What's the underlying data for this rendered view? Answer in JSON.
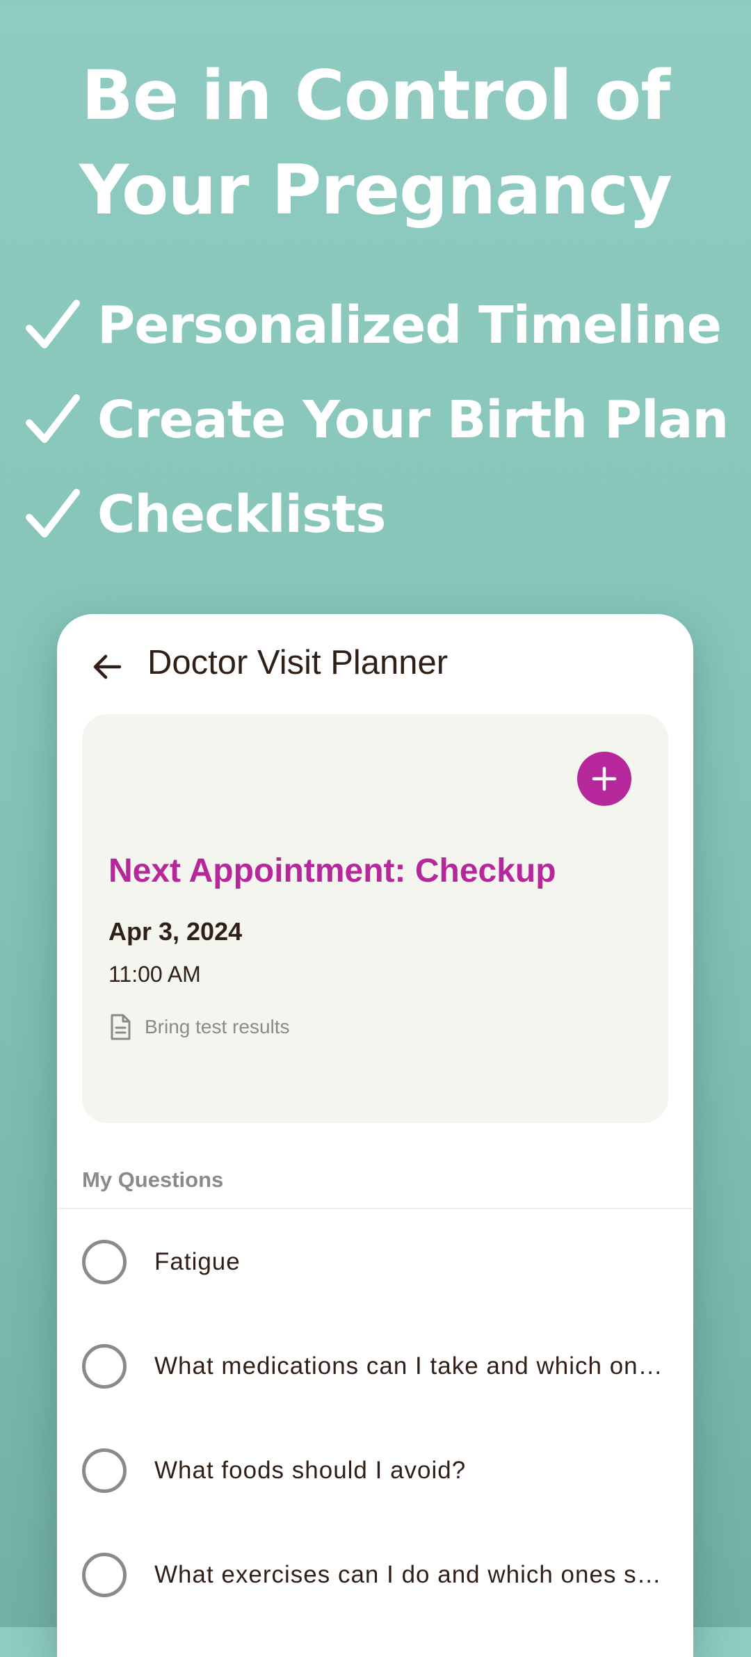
{
  "headline": {
    "line1": "Be in Control of",
    "line2": "Your Pregnancy"
  },
  "features": [
    {
      "icon": "check-icon",
      "label": "Personalized Timeline"
    },
    {
      "icon": "check-icon",
      "label": "Create Your Birth Plan"
    },
    {
      "icon": "check-icon",
      "label": "Checklists"
    }
  ],
  "app": {
    "title": "Doctor Visit Planner",
    "back_icon": "arrow-left-icon",
    "appointment": {
      "add_icon": "plus-icon",
      "title": "Next Appointment: Checkup",
      "date": "Apr 3, 2024",
      "time": "11:00 AM",
      "note_icon": "document-icon",
      "note": "Bring test results"
    },
    "questions_header": "My Questions",
    "questions": [
      {
        "text": "Fatigue",
        "checked": false
      },
      {
        "text": "What medications can I take and which ones should I avoid?",
        "checked": false
      },
      {
        "text": "What foods should I avoid?",
        "checked": false
      },
      {
        "text": "What exercises can I do and which ones should I avoid?",
        "checked": false
      }
    ]
  },
  "colors": {
    "background": "#86c4b8",
    "accent": "#b5279a",
    "text_dark": "#2f1f16",
    "text_muted": "#8a8a8a",
    "card_bg": "#f5f5f0"
  }
}
